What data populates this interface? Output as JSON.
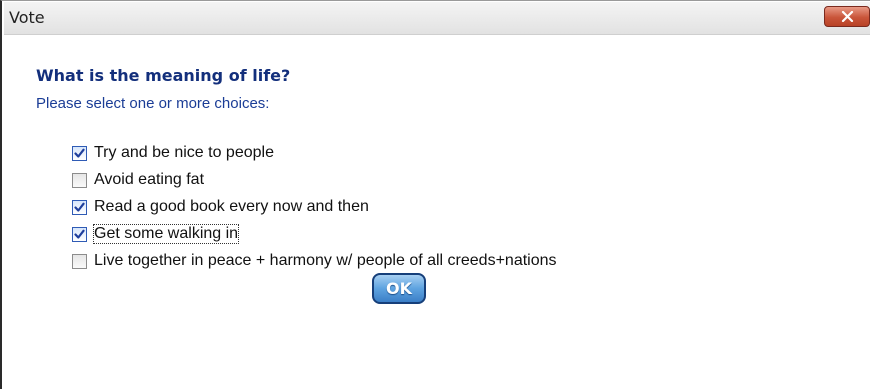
{
  "window": {
    "title": "Vote",
    "close_icon": "close-x-icon"
  },
  "dialog": {
    "question": "What is the meaning of life?",
    "instructions": "Please select one or more choices:",
    "choices": [
      {
        "label": "Try and be nice to people",
        "checked": true
      },
      {
        "label": "Avoid eating fat",
        "checked": false
      },
      {
        "label": "Read a good book every now and then",
        "checked": true
      },
      {
        "label": "Get some walking in",
        "checked": true,
        "focused": true
      },
      {
        "label": "Live together in peace + harmony w/ people of all creeds+nations",
        "checked": false
      }
    ],
    "ok_label": "OK"
  },
  "colors": {
    "question": "#132f7c",
    "instructions": "#1b3d96",
    "ok_button": "#5ea3e0",
    "close_button": "#c9553a"
  }
}
